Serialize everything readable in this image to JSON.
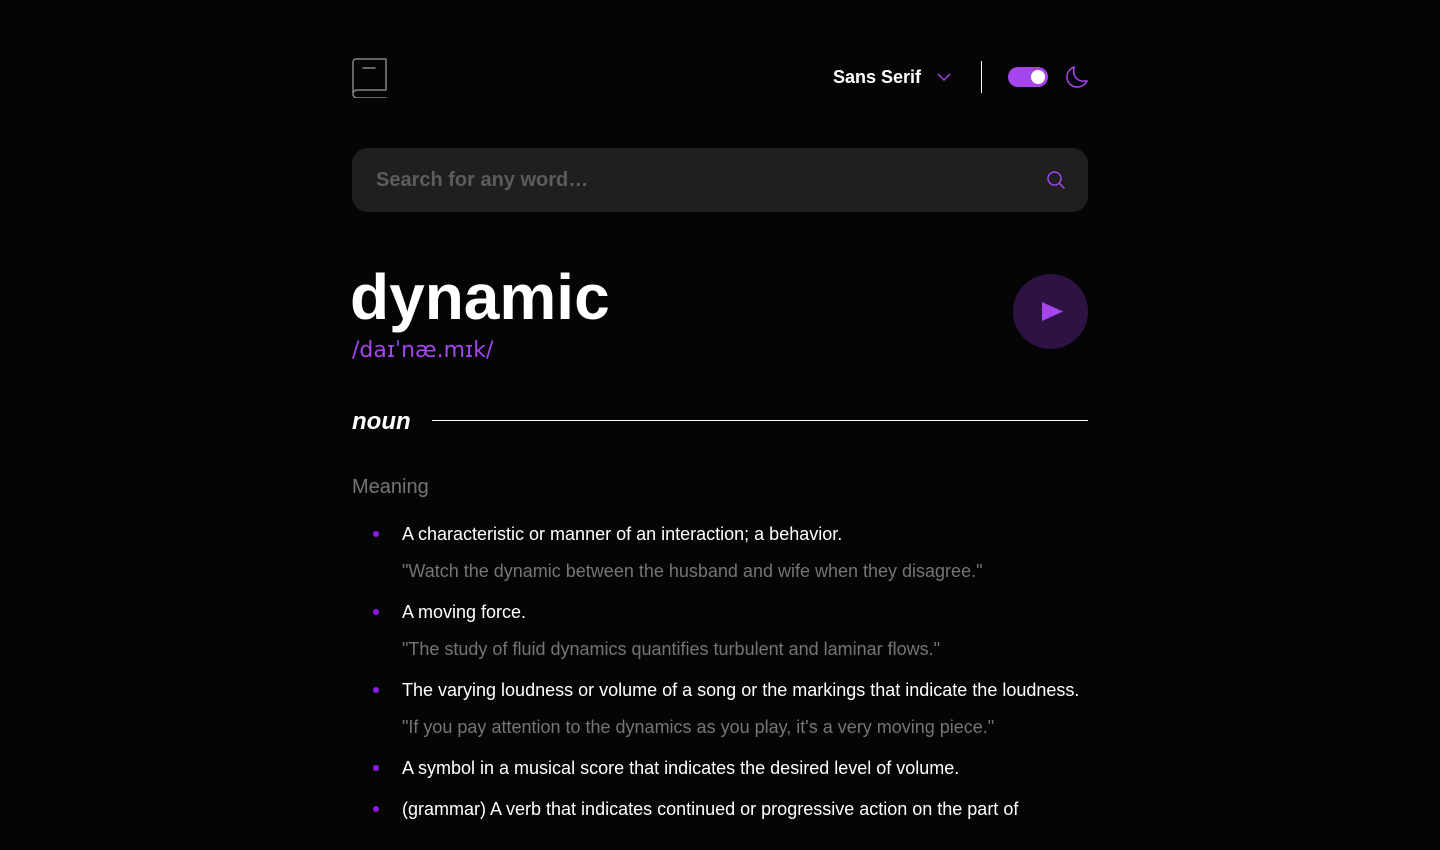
{
  "header": {
    "font_selector": {
      "label": "Sans Serif",
      "icon": "chevron-down-icon"
    },
    "theme_toggle": {
      "state": "dark",
      "icon": "moon-icon"
    },
    "logo_icon": "book-icon"
  },
  "search": {
    "placeholder": "Search for any word…",
    "value": "",
    "icon": "search-icon"
  },
  "entry": {
    "word": "dynamic",
    "phonetic": "/daɪˈnæ.mɪk/",
    "play_icon": "play-icon",
    "part_of_speech": "noun",
    "meaning_heading": "Meaning",
    "definitions": [
      {
        "text": "A characteristic or manner of an interaction; a behavior.",
        "example": "\"Watch the dynamic between the husband and wife when they disagree.\""
      },
      {
        "text": "A moving force.",
        "example": "\"The study of fluid dynamics quantifies turbulent and laminar flows.\""
      },
      {
        "text": "The varying loudness or volume of a song or the markings that indicate the loudness.",
        "example": "\"If you pay attention to the dynamics as you play, it's a very moving piece.\""
      },
      {
        "text": "A symbol in a musical score that indicates the desired level of volume."
      },
      {
        "text": "(grammar) A verb that indicates continued or progressive action on the part of"
      }
    ]
  },
  "colors": {
    "background": "#050505",
    "accent": "#a445ed",
    "search_bg": "#1f1f1f",
    "muted_text": "#757575",
    "play_bg": "#2d1343"
  }
}
